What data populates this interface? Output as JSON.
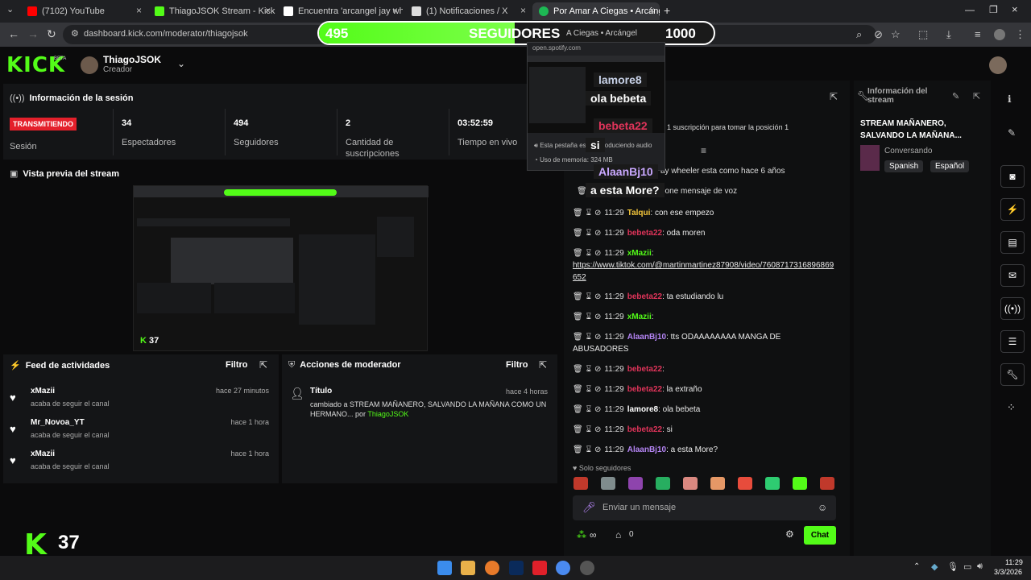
{
  "browser": {
    "tabs": [
      {
        "label": "(7102) YouTube",
        "color": "#ff0000"
      },
      {
        "label": "ThiagoJSOK Stream - Kick Dashb",
        "color": "#53fc18"
      },
      {
        "label": "Encuentra 'arcangel jay wheeler",
        "color": "#ffffff"
      },
      {
        "label": "(1) Notificaciones / X",
        "color": "#ffffff"
      },
      {
        "label": "Por Amar A Ciegas • Arcáng",
        "color": "#1db954"
      }
    ],
    "url": "dashboard.kick.com/moderator/thiagojsok"
  },
  "header": {
    "logo": "KICK",
    "beta": "BETA",
    "username": "ThiagoJSOK",
    "role": "Creador"
  },
  "session": {
    "title": "Información de la sesión",
    "badge": "TRANSMITIENDO",
    "stats": [
      {
        "label": "Sesión",
        "value": ""
      },
      {
        "label": "Espectadores",
        "value": "34"
      },
      {
        "label": "Seguidores",
        "value": "494"
      },
      {
        "label": "Cantidad de suscripciones",
        "value": "2"
      },
      {
        "label": "Tiempo en vivo",
        "value": "03:52:59"
      }
    ]
  },
  "preview": {
    "title": "Vista previa del stream",
    "mini_logo": "37"
  },
  "feed": {
    "title": "Feed de actividades",
    "filter": "Filtro",
    "items": [
      {
        "name": "xMazii",
        "sub": "acaba de seguir el canal",
        "time": "hace 27 minutos"
      },
      {
        "name": "Mr_Novoa_YT",
        "sub": "acaba de seguir el canal",
        "time": "hace 1 hora"
      },
      {
        "name": "xMazii",
        "sub": "acaba de seguir el canal",
        "time": "hace 1 hora"
      }
    ]
  },
  "modactions": {
    "title": "Acciones de moderador",
    "filter": "Filtro",
    "item": {
      "heading": "Título",
      "time": "hace 4 horas",
      "text": "cambiado a STREAM MAÑANERO, SALVANDO LA MAÑANA COMO UN HERMANO...",
      "por": "por",
      "user": "ThiagoJSOK"
    }
  },
  "chat": {
    "pinned": "1 suscripción para tomar la posición 1",
    "partial1": "ay wheeler esta como hace 6 años",
    "partial2": "pone mensaje de voz",
    "messages": [
      {
        "time": "11:29",
        "user": "Talqui",
        "ucls": "u-yellow",
        "text": ": con ese empezo"
      },
      {
        "time": "11:29",
        "user": "bebeta22",
        "ucls": "u-red",
        "text": ": oda moren"
      },
      {
        "time": "11:29",
        "user": "xMazii",
        "ucls": "u-green",
        "text": ":"
      },
      {
        "time": "11:29",
        "user": "bebeta22",
        "ucls": "u-red",
        "text": ": ta estudiando lu"
      },
      {
        "time": "11:29",
        "user": "xMazii",
        "ucls": "u-green",
        "text": ":"
      },
      {
        "time": "11:29",
        "user": "AlaanBj10",
        "ucls": "u-purple",
        "text": ": tts ODAAAAAAAA MANGA DE ABUSADORES"
      },
      {
        "time": "11:29",
        "user": "bebeta22",
        "ucls": "u-red",
        "text": ":"
      },
      {
        "time": "11:29",
        "user": "bebeta22",
        "ucls": "u-red",
        "text": ": la extraño"
      },
      {
        "time": "11:29",
        "user": "lamore8",
        "ucls": "u-white",
        "text": ": ola bebeta"
      },
      {
        "time": "11:29",
        "user": "bebeta22",
        "ucls": "u-red",
        "text": ": si"
      },
      {
        "time": "11:29",
        "user": "AlaanBj10",
        "ucls": "u-purple",
        "text": ": a esta More?"
      }
    ],
    "link": "https://www.tiktok.com/@martinmartinez87908/video/7608717316896869652",
    "followers_only": "Solo seguidores",
    "placeholder": "Enviar un mensaje",
    "count": "0",
    "send": "Chat"
  },
  "info": {
    "title": "Información del stream",
    "stream_title": "STREAM MAÑANERO, SALVANDO LA MAÑANA...",
    "category": "Conversando",
    "tags": [
      "Spanish",
      "Español"
    ]
  },
  "overlay": {
    "current": "495",
    "label": "SEGUIDORES",
    "goal": "1000",
    "progress": 0.495,
    "song_partial": "A Ciegas • Arcángel",
    "popup_url": "open.spotify.com",
    "popup_line1": "Esta pestaña está reproduciendo audio",
    "popup_line2": "Uso de memoria: 324 MB",
    "messages": [
      {
        "text": "lamore8",
        "color": "#c8d2e8",
        "bg": "#1a1a1a"
      },
      {
        "text": "ola bebeta",
        "color": "#ffffff",
        "bg": "#1a1a1a"
      },
      {
        "text": "bebeta22",
        "color": "#e0345a",
        "bg": "#1a1a1a"
      },
      {
        "text": "si",
        "color": "#ffffff",
        "bg": "#1a1a1a"
      },
      {
        "text": "AlaanBj10",
        "color": "#c9a8ff",
        "bg": "#1a1a1a"
      },
      {
        "text": "a esta More?",
        "color": "#ffffff",
        "bg": "#1a1a1a"
      }
    ]
  },
  "taskbar": {
    "time": "11:29",
    "date": "3/3/2026"
  }
}
